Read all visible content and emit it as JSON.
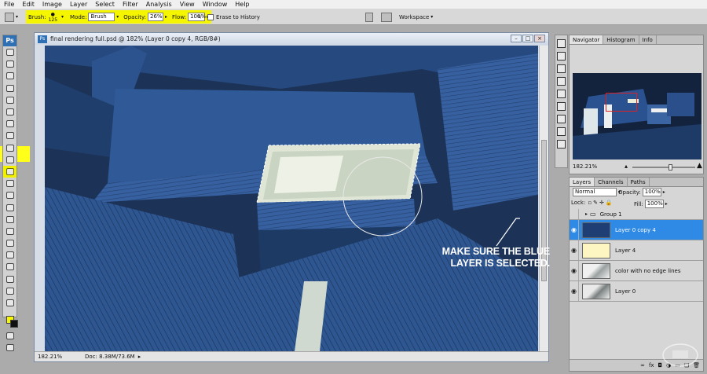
{
  "menu": [
    "File",
    "Edit",
    "Image",
    "Layer",
    "Select",
    "Filter",
    "Analysis",
    "View",
    "Window",
    "Help"
  ],
  "options": {
    "brush_label": "Brush:",
    "brush_size": "125",
    "mode_label": "Mode:",
    "mode_value": "Brush",
    "opacity_label": "Opacity:",
    "opacity_value": "26%",
    "flow_label": "Flow:",
    "flow_value": "100%",
    "erase_history_label": "Erase to History",
    "workspace_label": "Workspace"
  },
  "toolbox": {
    "logo": "Ps",
    "highlight_color": "#ffff19",
    "foreground_color": "#f6f600",
    "background_color": "#101010"
  },
  "document": {
    "title": "final rendering full.psd @ 182% (Layer 0 copy 4, RGB/8#)",
    "zoom_status": "182.21%",
    "doc_size": "Doc: 8.38M/73.6M"
  },
  "navigator": {
    "tabs": [
      "Navigator",
      "Histogram",
      "Info"
    ],
    "zoom": "182.21%"
  },
  "layers": {
    "tabs": [
      "Layers",
      "Channels",
      "Paths"
    ],
    "blend_mode": "Normal",
    "opacity_label": "Opacity:",
    "opacity_value": "100%",
    "lock_label": "Lock:",
    "fill_label": "Fill:",
    "fill_value": "100%",
    "group": "Group 1",
    "items": [
      {
        "name": "Layer 0 copy 4",
        "selected": true
      },
      {
        "name": "Layer 4",
        "selected": false
      },
      {
        "name": "color with no edge lines",
        "selected": false
      },
      {
        "name": "Layer 0",
        "selected": false
      }
    ],
    "footer_icons": [
      "link-icon",
      "fx-icon",
      "mask-icon",
      "adjustment-icon",
      "folder-icon",
      "new-layer-icon",
      "trash-icon"
    ]
  },
  "annotation": {
    "line1": "MAKE SURE THE BLUE",
    "line2": "LAYER IS SELECTED."
  },
  "colors": {
    "selected_layer": "#2f8ae6",
    "canvas_blue": "#2b4f86"
  }
}
